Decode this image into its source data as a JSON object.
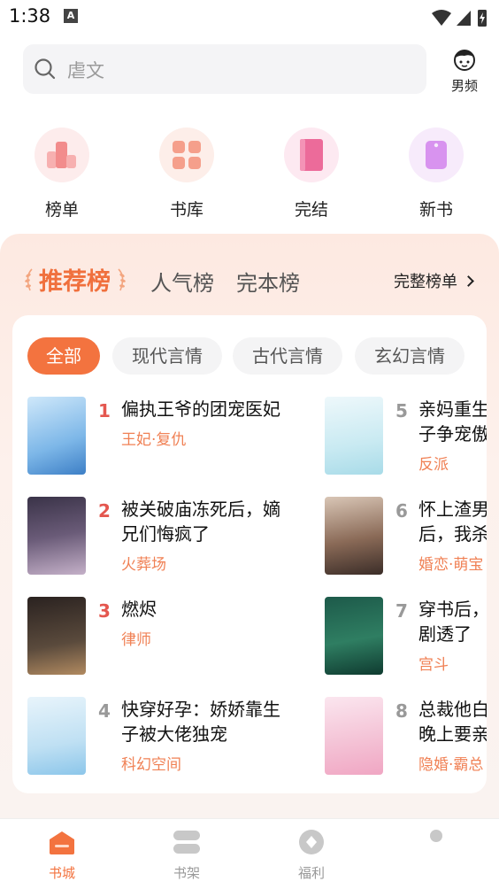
{
  "status_bar": {
    "time": "1:38",
    "notif_letter": "A"
  },
  "search": {
    "placeholder": "虐文"
  },
  "gender_switch": {
    "label": "男频"
  },
  "categories": [
    {
      "label": "榜单",
      "color": "#f6a3a3"
    },
    {
      "label": "书库",
      "color": "#f59a8a"
    },
    {
      "label": "完结",
      "color": "#ef6e9c"
    },
    {
      "label": "新书",
      "color": "#d891f0"
    }
  ],
  "rank_tabs": {
    "main": "推荐榜",
    "tab2": "人气榜",
    "tab3": "完本榜",
    "full_list": "完整榜单"
  },
  "filters": [
    "全部",
    "现代言情",
    "古代言情",
    "玄幻言情"
  ],
  "books": [
    {
      "rank": "1",
      "title": "偏执王爷的团宠医妃",
      "tag": "王妃·复仇"
    },
    {
      "rank": "2",
      "title": "被关破庙冻死后，嫡\n兄们悔疯了",
      "tag": "火葬场"
    },
    {
      "rank": "3",
      "title": "燃烬",
      "tag": "律师"
    },
    {
      "rank": "4",
      "title": "快穿好孕：娇娇靠生\n子被大佬独宠",
      "tag": "科幻空间"
    },
    {
      "rank": "5",
      "title": "亲妈重生\n子争宠傲",
      "tag": "反派"
    },
    {
      "rank": "6",
      "title": "怀上渣男\n后，我杀",
      "tag": "婚恋·萌宝"
    },
    {
      "rank": "7",
      "title": "穿书后，\n剧透了",
      "tag": "宫斗"
    },
    {
      "rank": "8",
      "title": "总裁他白\n晚上要亲",
      "tag": "隐婚·霸总"
    }
  ],
  "bottom_nav": [
    {
      "label": "书城",
      "active": true
    },
    {
      "label": "书架",
      "active": false
    },
    {
      "label": "福利",
      "active": false
    }
  ],
  "colors": {
    "accent": "#f3733f",
    "rank_top": "#e4574f",
    "rank_other": "#999999"
  }
}
